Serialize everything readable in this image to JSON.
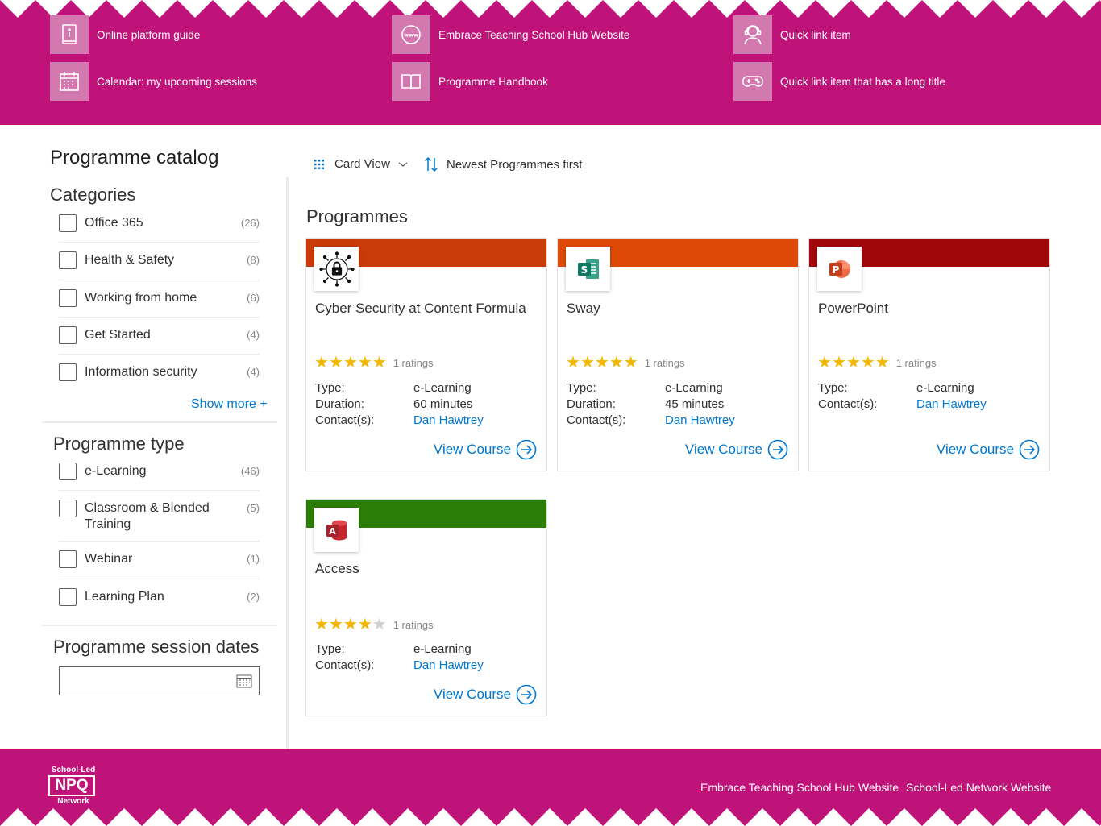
{
  "header": {
    "quick_links": [
      {
        "label": "Online platform guide",
        "icon": "book-info-icon"
      },
      {
        "label": "Calendar: my upcoming sessions",
        "icon": "calendar-icon"
      },
      {
        "label": "Embrace Teaching School Hub Website",
        "icon": "globe-www-icon"
      },
      {
        "label": "Programme Handbook",
        "icon": "open-book-icon"
      },
      {
        "label": "Quick link item",
        "icon": "headset-person-icon"
      },
      {
        "label": "Quick link item that has a long title",
        "icon": "gamepad-icon"
      }
    ]
  },
  "sidebar": {
    "title": "Programme catalog",
    "categories": {
      "title": "Categories",
      "items": [
        {
          "label": "Office 365",
          "count": "(26)"
        },
        {
          "label": "Health & Safety",
          "count": "(8)"
        },
        {
          "label": "Working from home",
          "count": "(6)"
        },
        {
          "label": "Get Started",
          "count": "(4)"
        },
        {
          "label": "Information security",
          "count": "(4)"
        }
      ],
      "show_more": "Show more +"
    },
    "programme_type": {
      "title": "Programme type",
      "items": [
        {
          "label": "e-Learning",
          "count": "(46)"
        },
        {
          "label": "Classroom & Blended Training",
          "count": "(5)"
        },
        {
          "label": "Webinar",
          "count": "(1)"
        },
        {
          "label": "Learning Plan",
          "count": "(2)"
        }
      ]
    },
    "session_dates": {
      "title": "Programme session dates",
      "value": ""
    }
  },
  "toolbar": {
    "view_label": "Card View",
    "sort_label": "Newest Programmes first"
  },
  "main": {
    "title": "Programmes",
    "cards": [
      {
        "title": "Cyber Security at Content Formula",
        "band_color": "#c93b08",
        "icon": "cyber-lock-icon",
        "stars": 5,
        "ratings": "1 ratings",
        "meta": [
          {
            "key": "Type:",
            "value": "e-Learning"
          },
          {
            "key": "Duration:",
            "value": "60 minutes"
          },
          {
            "key": "Contact(s):",
            "value": "Dan Hawtrey"
          }
        ],
        "action": "View Course"
      },
      {
        "title": "Sway",
        "band_color": "#de4a06",
        "icon": "sway-icon",
        "stars": 5,
        "ratings": "1 ratings",
        "meta": [
          {
            "key": "Type:",
            "value": "e-Learning"
          },
          {
            "key": "Duration:",
            "value": "45 minutes"
          },
          {
            "key": "Contact(s):",
            "value": "Dan Hawtrey"
          }
        ],
        "action": "View Course"
      },
      {
        "title": "PowerPoint",
        "band_color": "#a1060b",
        "icon": "powerpoint-icon",
        "stars": 5,
        "ratings": "1 ratings",
        "meta": [
          {
            "key": "Type:",
            "value": "e-Learning"
          },
          {
            "key": "Contact(s):",
            "value": "Dan Hawtrey"
          }
        ],
        "action": "View Course"
      },
      {
        "title": "Access",
        "band_color": "#2a7d06",
        "icon": "access-icon",
        "stars": 4,
        "ratings": "1 ratings",
        "meta": [
          {
            "key": "Type:",
            "value": "e-Learning"
          },
          {
            "key": "Contact(s):",
            "value": "Dan Hawtrey"
          }
        ],
        "action": "View Course"
      }
    ]
  },
  "footer": {
    "logo": {
      "top": "School-Led",
      "middle": "NPQ",
      "bottom": "Network"
    },
    "links": [
      "Embrace Teaching School Hub Website",
      "School-Led Network Website"
    ]
  },
  "colors": {
    "brand": "#bf137a",
    "link": "#0078d4",
    "star": "#f2b705"
  }
}
